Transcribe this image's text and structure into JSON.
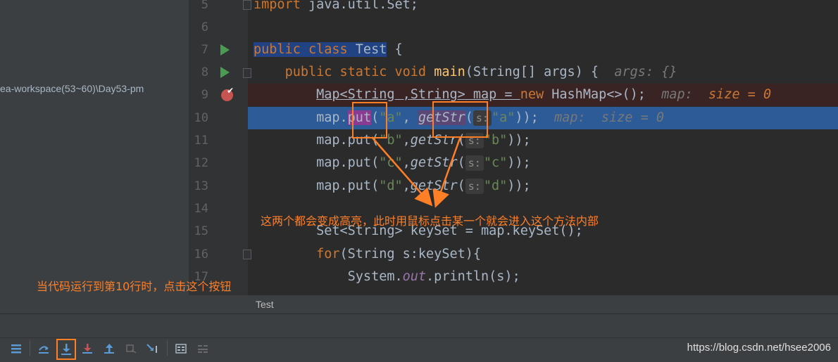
{
  "project": {
    "path": "ea-workspace(53~60)\\Day53-pm"
  },
  "editor": {
    "lines": [
      {
        "num": "5"
      },
      {
        "num": "6"
      },
      {
        "num": "7"
      },
      {
        "num": "8"
      },
      {
        "num": "9"
      },
      {
        "num": "10"
      },
      {
        "num": "11"
      },
      {
        "num": "12"
      },
      {
        "num": "13"
      },
      {
        "num": "14"
      },
      {
        "num": "15"
      },
      {
        "num": "16"
      },
      {
        "num": "17"
      }
    ],
    "code": {
      "l5_kw": "import",
      "l5_rest": " java.util.Set;",
      "l7_kw": "public class",
      "l7_name": " Test",
      "l7_rest": " {",
      "l8_kw": "public static void",
      "l8_fn": "main",
      "l8_rest": "(String[] args) {",
      "l8_hint": "args: {}",
      "l9_a": "Map<String ,String> map = ",
      "l9_new": "new",
      "l9_b": " HashMap<>();",
      "l9_hint": "map:",
      "l9_hintv": "size = 0",
      "l10_map": "map.",
      "l10_put": "put",
      "l10_a": "(",
      "l10_str1": "\"a\"",
      "l10_b": ", ",
      "l10_get": "getStr",
      "l10_c": "(",
      "l10_param": "s:",
      "l10_str2": "\"a\"",
      "l10_d": "));",
      "l10_hint": "map:",
      "l10_hintv": "size = 0",
      "l11_a": "map.put(",
      "l11_s1": "\"b\"",
      "l11_b": ",",
      "l11_get": "getStr",
      "l11_c": "(",
      "l11_param": "s:",
      "l11_s2": "\"b\"",
      "l11_d": "));",
      "l12_a": "map.put(",
      "l12_s1": "\"c\"",
      "l12_b": ",",
      "l12_get": "getStr",
      "l12_c": "(",
      "l12_param": "s:",
      "l12_s2": "\"c\"",
      "l12_d": "));",
      "l13_a": "map.put(",
      "l13_s1": "\"d\"",
      "l13_b": ",",
      "l13_get": "getStr",
      "l13_c": "(",
      "l13_param": "s:",
      "l13_s2": "\"d\"",
      "l13_d": "));",
      "l15": "Set<String> keySet = map.keySet();",
      "l16_kw": "for",
      "l16_rest": "(String s:keySet){",
      "l17_a": "System.",
      "l17_out": "out",
      "l17_b": ".println(s);"
    }
  },
  "tab": {
    "label": "Test"
  },
  "annotations": {
    "highlight_note": "这两个都会变成高亮，此时用鼠标点击某一个就会进入这个方法内部",
    "button_note": "当代码运行到第10行时，点击这个按钮"
  },
  "toolbar": {
    "buttons": [
      "show-execution-point-icon",
      "step-over-icon",
      "step-into-icon",
      "force-step-into-icon",
      "step-out-icon",
      "drop-frame-icon",
      "run-to-cursor-icon",
      "evaluate-expression-icon",
      "trace-icon"
    ]
  },
  "watermark": "https://blog.csdn.net/hsee2006",
  "colors": {
    "annotation": "#ff7f27",
    "current_line": "#2d5b97",
    "breakpoint": "#c75450"
  }
}
